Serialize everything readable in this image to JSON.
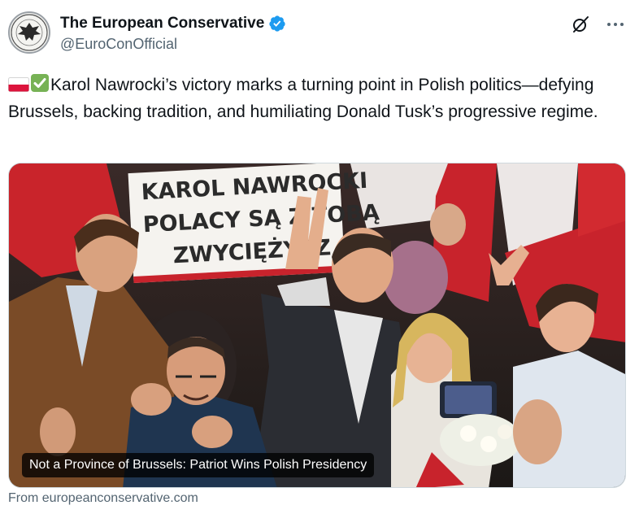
{
  "author": {
    "display_name": "The European Conservative",
    "handle": "@EuroConOfficial",
    "verified": true,
    "verified_color": "#1d9bf0"
  },
  "header_icons": [
    "grok-icon",
    "more-icon"
  ],
  "tweet": {
    "emojis": [
      "poland-flag-emoji",
      "check-mark-emoji"
    ],
    "text": "Karol Nawrocki’s victory marks a turning point in Polish politics—defying Brussels, backing tradition, and humiliating Donald Tusk’s progressive regime."
  },
  "card": {
    "sign_lines": [
      "KAROL NAWROCKI",
      "POLACY SĄ Z TOBĄ",
      "ZWYCIĘŻYSZ"
    ],
    "title": "Not a Province of Brussels: Patriot Wins Polish Presidency",
    "source": "From europeanconservative.com"
  },
  "colors": {
    "text": "#0f1419",
    "secondary": "#536471",
    "flag_red": "#dc143c",
    "check_green": "#77b255"
  }
}
